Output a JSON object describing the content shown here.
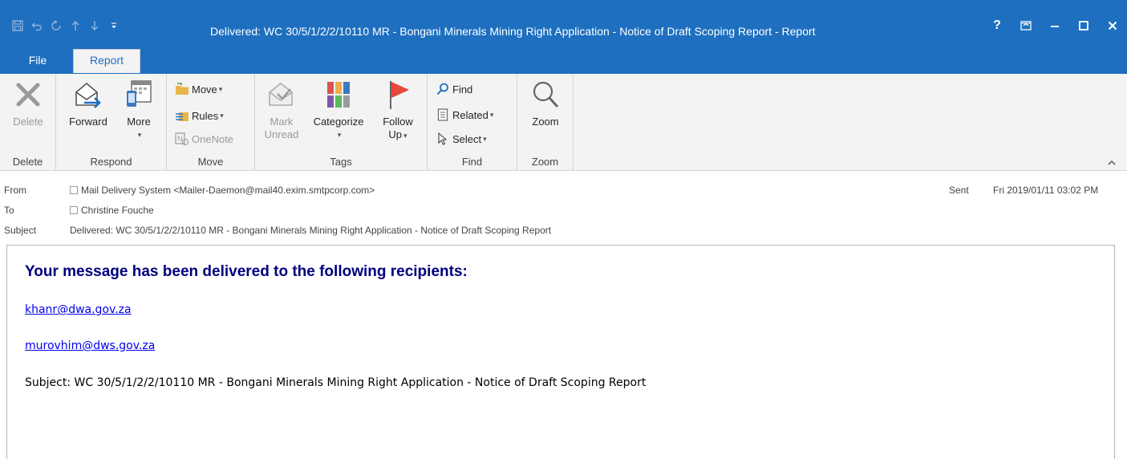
{
  "window": {
    "title": "Delivered: WC 30/5/1/2/2/10110 MR - Bongani Minerals Mining Right Application - Notice of Draft Scoping Report  -  Report",
    "controls": [
      "?",
      "⊡",
      "–",
      "☐",
      "✕"
    ]
  },
  "quick_access": [
    "save-icon",
    "undo-icon",
    "redo-icon",
    "up-icon",
    "down-icon",
    "customize-icon"
  ],
  "tabs": {
    "file": "File",
    "report": "Report"
  },
  "ribbon": {
    "groups": {
      "delete": "Delete",
      "respond": "Respond",
      "move": "Move",
      "tags": "Tags",
      "find": "Find",
      "zoom": "Zoom"
    },
    "buttons": {
      "delete": "Delete",
      "forward": "Forward",
      "more": "More",
      "move": "Move",
      "rules": "Rules",
      "onenote": "OneNote",
      "mark_unread_1": "Mark",
      "mark_unread_2": "Unread",
      "categorize": "Categorize",
      "follow_up_1": "Follow",
      "follow_up_2": "Up",
      "find": "Find",
      "related": "Related",
      "select": "Select",
      "zoom": "Zoom"
    }
  },
  "header": {
    "from_label": "From",
    "from_value": "Mail Delivery System <Mailer-Daemon@mail40.exim.smtpcorp.com>",
    "to_label": "To",
    "to_value": "Christine Fouche",
    "subject_label": "Subject",
    "subject_value": "Delivered: WC 30/5/1/2/2/10110 MR - Bongani Minerals Mining Right Application - Notice of Draft Scoping Report",
    "sent_label": "Sent",
    "sent_value": "Fri 2019/01/11 03:02 PM"
  },
  "body": {
    "heading": "Your message has been delivered to the following recipients:",
    "recipients": [
      "khanr@dwa.gov.za",
      "murovhim@dws.gov.za"
    ],
    "subject_line": "Subject: WC 30/5/1/2/2/10110 MR - Bongani Minerals Mining Right Application - Notice of Draft Scoping Report"
  },
  "colors": {
    "titlebar": "#1e6fbf",
    "heading": "#00007f",
    "link": "#0000ee",
    "follow_flag": "#e8473b"
  }
}
